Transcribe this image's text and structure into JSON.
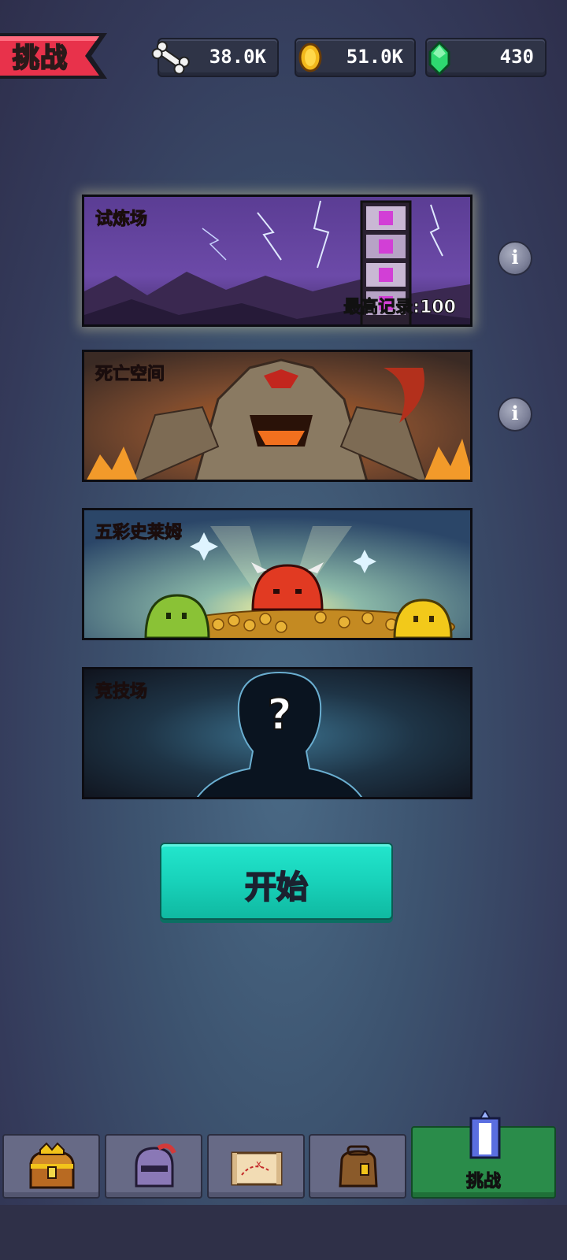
{
  "header": {
    "title": "挑战",
    "resources": [
      {
        "name": "bones",
        "icon": "bone-icon",
        "value": "38.0K"
      },
      {
        "name": "coins",
        "icon": "coin-icon",
        "value": "51.0K"
      },
      {
        "name": "gems",
        "icon": "gem-icon",
        "value": "430"
      }
    ]
  },
  "modes": [
    {
      "title": "试炼场",
      "record": "最高记录:100",
      "title_color": "#b45cf0"
    },
    {
      "title": "死亡空间",
      "title_color": "#e0241e"
    },
    {
      "title": "五彩史莱姆",
      "title_color": "#e0301e"
    },
    {
      "title": "竞技场",
      "title_color": "#e6902a"
    }
  ],
  "start_label": "开始",
  "nav": {
    "items": [
      {
        "name": "treasure-chest-icon"
      },
      {
        "name": "knight-helmet-icon"
      },
      {
        "name": "map-scroll-icon"
      },
      {
        "name": "backpack-icon"
      }
    ],
    "active_label": "挑战"
  },
  "colors": {
    "accent": "#1ad9c0",
    "nav_active": "#2a8c4a"
  }
}
